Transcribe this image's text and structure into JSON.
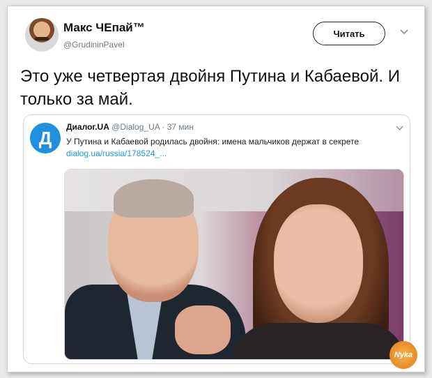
{
  "author": {
    "name": "Макс ЧЕпай™",
    "handle": "@GrudininPavel"
  },
  "follow_button": {
    "label": "Читать"
  },
  "tweet": {
    "text": "Это уже четвертая двойня Путина и Кабаевой. И только за май."
  },
  "quoted_tweet": {
    "avatar_letter": "Д",
    "name": "Диалог.UA",
    "meta": "@Dialog_UA · 37 мин",
    "text": "У Путина и Кабаевой родилась двойня: имена мальчиков держат в секрете",
    "link": "dialog.ua/russia/178524_..."
  },
  "watermark": {
    "text": "Nyka"
  },
  "colors": {
    "link": "#1b95e0",
    "avatar_bg": "#1f8fe0",
    "watermark": "#e07a1a"
  },
  "icons": {
    "chevron": "chevron-down-icon"
  }
}
